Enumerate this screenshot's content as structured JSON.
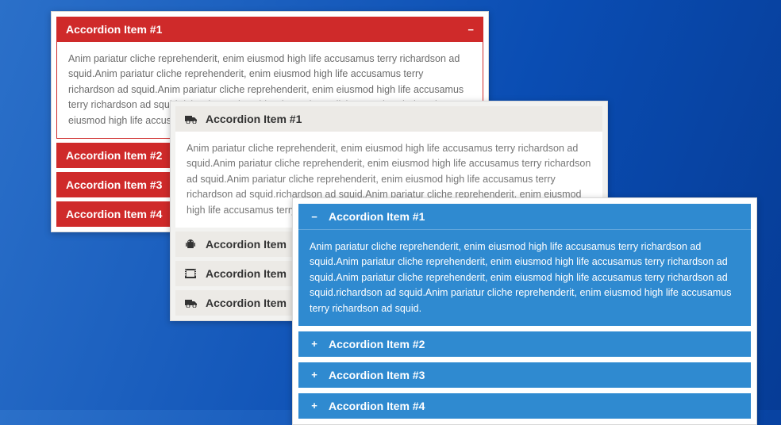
{
  "body_text": "Anim pariatur cliche reprehenderit, enim eiusmod high life accusamus terry richardson ad squid.Anim pariatur cliche reprehenderit, enim eiusmod high life accusamus terry richardson ad squid.Anim pariatur cliche reprehenderit, enim eiusmod high life accusamus terry richardson ad squid.richardson ad squid.Anim pariatur cliche reprehenderit, enim eiusmod high life accusamus terry richardson ad squid.",
  "red": {
    "items": [
      {
        "label": "Accordion Item #1",
        "expanded": true,
        "toggle": "−"
      },
      {
        "label": "Accordion Item #2"
      },
      {
        "label": "Accordion Item #3"
      },
      {
        "label": "Accordion Item #4"
      }
    ]
  },
  "grey": {
    "items": [
      {
        "label": "Accordion Item #1",
        "icon": "truck",
        "expanded": true
      },
      {
        "label": "Accordion Item",
        "icon": "android"
      },
      {
        "label": "Accordion Item",
        "icon": "film"
      },
      {
        "label": "Accordion Item",
        "icon": "truck"
      }
    ]
  },
  "blue": {
    "items": [
      {
        "label": "Accordion Item #1",
        "toggle": "−",
        "expanded": true
      },
      {
        "label": "Accordion Item #2",
        "toggle": "+"
      },
      {
        "label": "Accordion Item #3",
        "toggle": "+"
      },
      {
        "label": "Accordion Item #4",
        "toggle": "+"
      }
    ]
  }
}
